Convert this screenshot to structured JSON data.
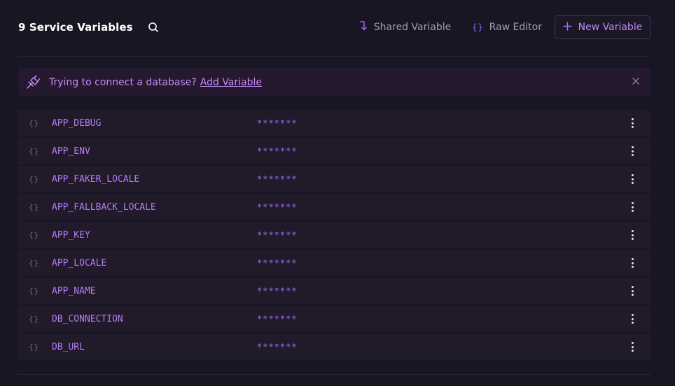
{
  "header": {
    "title": "9 Service Variables",
    "search_icon": "search-icon",
    "shared_label": "Shared Variable",
    "shared_icon": "arrow-down-right-icon",
    "raw_label": "Raw Editor",
    "raw_icon": "braces-icon",
    "new_label": "New Variable",
    "new_icon": "plus-icon"
  },
  "banner": {
    "icon": "plug-icon",
    "text": "Trying to connect a database?",
    "link": "Add Variable",
    "close_icon": "close-icon"
  },
  "variables": [
    {
      "name": "APP_DEBUG",
      "value": "*******"
    },
    {
      "name": "APP_ENV",
      "value": "*******"
    },
    {
      "name": "APP_FAKER_LOCALE",
      "value": "*******"
    },
    {
      "name": "APP_FALLBACK_LOCALE",
      "value": "*******"
    },
    {
      "name": "APP_KEY",
      "value": "*******"
    },
    {
      "name": "APP_LOCALE",
      "value": "*******"
    },
    {
      "name": "APP_NAME",
      "value": "*******"
    },
    {
      "name": "DB_CONNECTION",
      "value": "*******"
    },
    {
      "name": "DB_URL",
      "value": "*******"
    }
  ],
  "row_braces": "{}",
  "colors": {
    "background": "#191624",
    "accent": "#a35ef0",
    "banner_bg": "#24192f",
    "row_bg": "#201a2b"
  }
}
